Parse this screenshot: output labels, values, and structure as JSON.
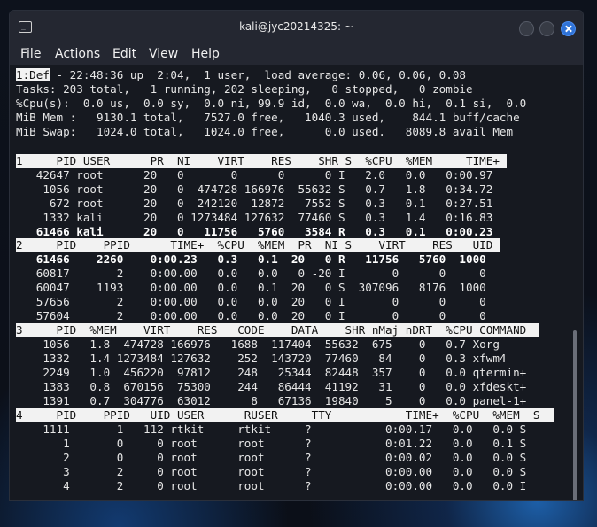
{
  "window": {
    "title": "kali@jyc20214325: ~"
  },
  "menu": [
    "File",
    "Actions",
    "Edit",
    "View",
    "Help"
  ],
  "summary": {
    "win_label": "1:Def",
    "line1_rest": " - 22:48:36 up  2:04,  1 user,  load average: 0.06, 0.06, 0.08",
    "tasks": "Tasks: 203 total,   1 running, 202 sleeping,   0 stopped,   0 zombie",
    "cpu": "%Cpu(s):  0.0 us,  0.0 sy,  0.0 ni, 99.9 id,  0.0 wa,  0.0 hi,  0.1 si,  0.0",
    "mem": "MiB Mem :   9130.1 total,   7527.0 free,   1040.3 used,    844.1 buff/cache",
    "swap": "MiB Swap:   1024.0 total,   1024.0 free,      0.0 used.   8089.8 avail Mem"
  },
  "windows": [
    {
      "header": "1     PID USER      PR  NI    VIRT    RES    SHR S  %CPU  %MEM     TIME+ ",
      "rows": [
        {
          "text": "   42647 root      20   0       0      0      0 I   2.0   0.0   0:00.97",
          "bold": false
        },
        {
          "text": "    1056 root      20   0  474728 166976  55632 S   0.7   1.8   0:34.72",
          "bold": false
        },
        {
          "text": "     672 root      20   0  242120  12872   7552 S   0.3   0.1   0:27.51",
          "bold": false
        },
        {
          "text": "    1332 kali      20   0 1273484 127632  77460 S   0.3   1.4   0:16.83",
          "bold": false
        },
        {
          "text": "   61466 kali      20   0   11756   5760   3584 R   0.3   0.1   0:00.23",
          "bold": true
        }
      ]
    },
    {
      "header": "2     PID    PPID      TIME+  %CPU  %MEM  PR  NI S    VIRT    RES   UID ",
      "rows": [
        {
          "text": "   61466    2260    0:00.23   0.3   0.1  20   0 R   11756   5760  1000",
          "bold": true
        },
        {
          "text": "   60817       2    0:00.00   0.0   0.0   0 -20 I       0      0     0",
          "bold": false
        },
        {
          "text": "   60047    1193    0:00.00   0.0   0.1  20   0 S  307096   8176  1000",
          "bold": false
        },
        {
          "text": "   57656       2    0:00.00   0.0   0.0  20   0 I       0      0     0",
          "bold": false
        },
        {
          "text": "   57604       2    0:00.00   0.0   0.0  20   0 I       0      0     0",
          "bold": false
        }
      ]
    },
    {
      "header": "3     PID  %MEM    VIRT    RES   CODE    DATA    SHR nMaj nDRT  %CPU COMMAND  ",
      "rows": [
        {
          "text": "    1056   1.8  474728 166976   1688  117404  55632  675    0   0.7 Xorg",
          "bold": false
        },
        {
          "text": "    1332   1.4 1273484 127632    252  143720  77460   84    0   0.3 xfwm4",
          "bold": false
        },
        {
          "text": "    2249   1.0  456220  97812    248   25344  82448  357    0   0.0 qtermin+",
          "bold": false
        },
        {
          "text": "    1383   0.8  670156  75300    244   86444  41192   31    0   0.0 xfdeskt+",
          "bold": false
        },
        {
          "text": "    1391   0.7  304776  63012      8   67136  19840    5    0   0.0 panel-1+",
          "bold": false
        }
      ]
    },
    {
      "header": "4     PID    PPID   UID USER      RUSER     TTY           TIME+  %CPU  %MEM  S  ",
      "rows": [
        {
          "text": "    1111       1   112 rtkit     rtkit     ?           0:00.17   0.0   0.0 S",
          "bold": false
        },
        {
          "text": "       1       0     0 root      root      ?           0:01.22   0.0   0.1 S",
          "bold": false
        },
        {
          "text": "       2       0     0 root      root      ?           0:00.02   0.0   0.0 S",
          "bold": false
        },
        {
          "text": "       3       2     0 root      root      ?           0:00.00   0.0   0.0 S",
          "bold": false
        },
        {
          "text": "       4       2     0 root      root      ?           0:00.00   0.0   0.0 I",
          "bold": false
        }
      ]
    }
  ]
}
